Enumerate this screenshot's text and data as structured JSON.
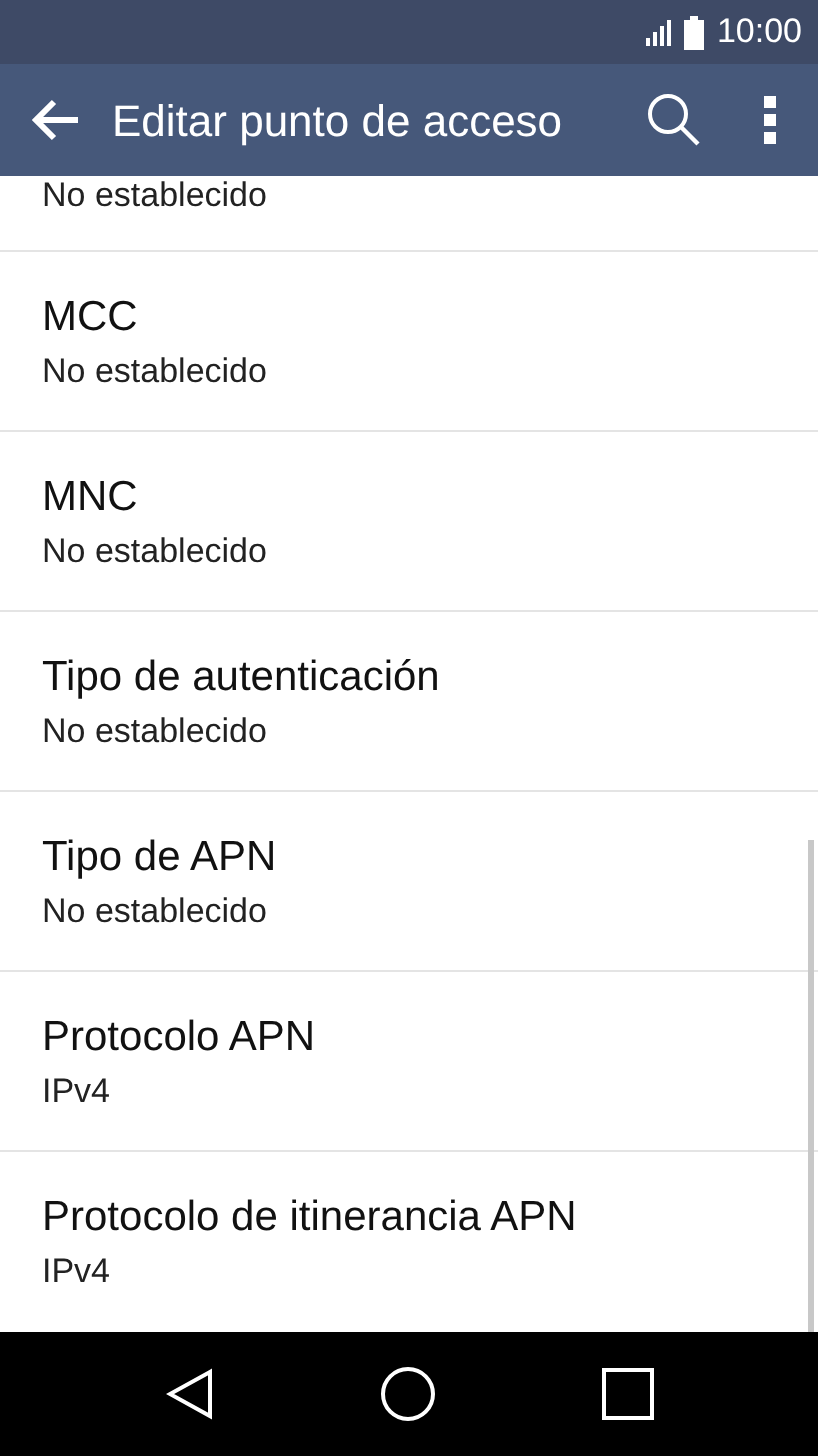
{
  "status_bar": {
    "time": "10:00"
  },
  "app_bar": {
    "title": "Editar punto de acceso"
  },
  "partial_item": {
    "value": "No establecido"
  },
  "items": [
    {
      "title": "MCC",
      "value": "No establecido"
    },
    {
      "title": "MNC",
      "value": "No establecido"
    },
    {
      "title": "Tipo de autenticación",
      "value": "No establecido"
    },
    {
      "title": "Tipo de APN",
      "value": "No establecido"
    },
    {
      "title": "Protocolo APN",
      "value": "IPv4"
    },
    {
      "title": "Protocolo de itinerancia APN",
      "value": "IPv4"
    }
  ]
}
